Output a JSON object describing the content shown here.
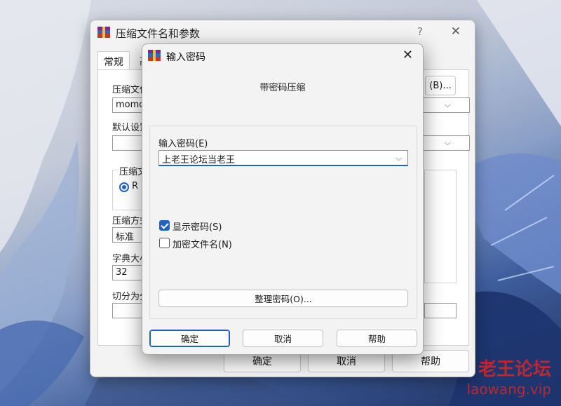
{
  "colors": {
    "accent": "#1f63c2",
    "watermark": "#d22828"
  },
  "back_dialog": {
    "title": "压缩文件名和参数",
    "help_glyph": "?",
    "close_glyph": "✕",
    "tabs": [
      "常规",
      "高"
    ],
    "archive_name_label": "压缩文件",
    "archive_name_value": "momo.",
    "browse_button": "(B)...",
    "default_profile_label": "默认设置",
    "archive_format_group": "压缩文",
    "archive_format_radio": "R",
    "method_label": "压缩方式",
    "method_value": "标准",
    "dict_label": "字典大小",
    "dict_value": "32",
    "split_label": "切分为分",
    "ok": "确定",
    "cancel": "取消",
    "help": "帮助"
  },
  "password_dialog": {
    "title": "输入密码",
    "close_glyph": "✕",
    "subtitle": "带密码压缩",
    "password_label": "输入密码(E)",
    "password_value": "上老王论坛当老王",
    "show_password": {
      "label": "显示密码(S)",
      "checked": true
    },
    "encrypt_names": {
      "label": "加密文件名(N)",
      "checked": false
    },
    "organize_button": "整理密码(O)...",
    "ok": "确定",
    "cancel": "取消",
    "help": "帮助"
  },
  "watermark": {
    "title": "老王论坛",
    "url": "laowang.vip"
  }
}
